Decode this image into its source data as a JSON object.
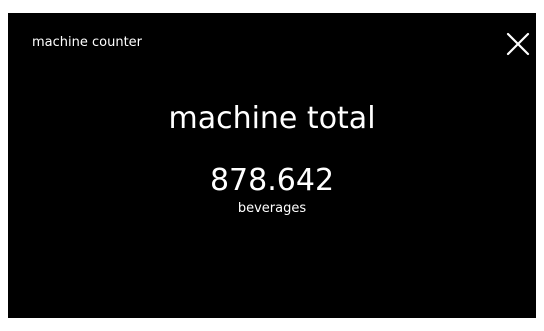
{
  "header": {
    "title": "machine counter",
    "close_icon": "close-icon"
  },
  "main": {
    "heading": "machine total",
    "value": "878.642",
    "unit": "beverages"
  },
  "colors": {
    "background": "#000000",
    "text": "#ffffff"
  }
}
